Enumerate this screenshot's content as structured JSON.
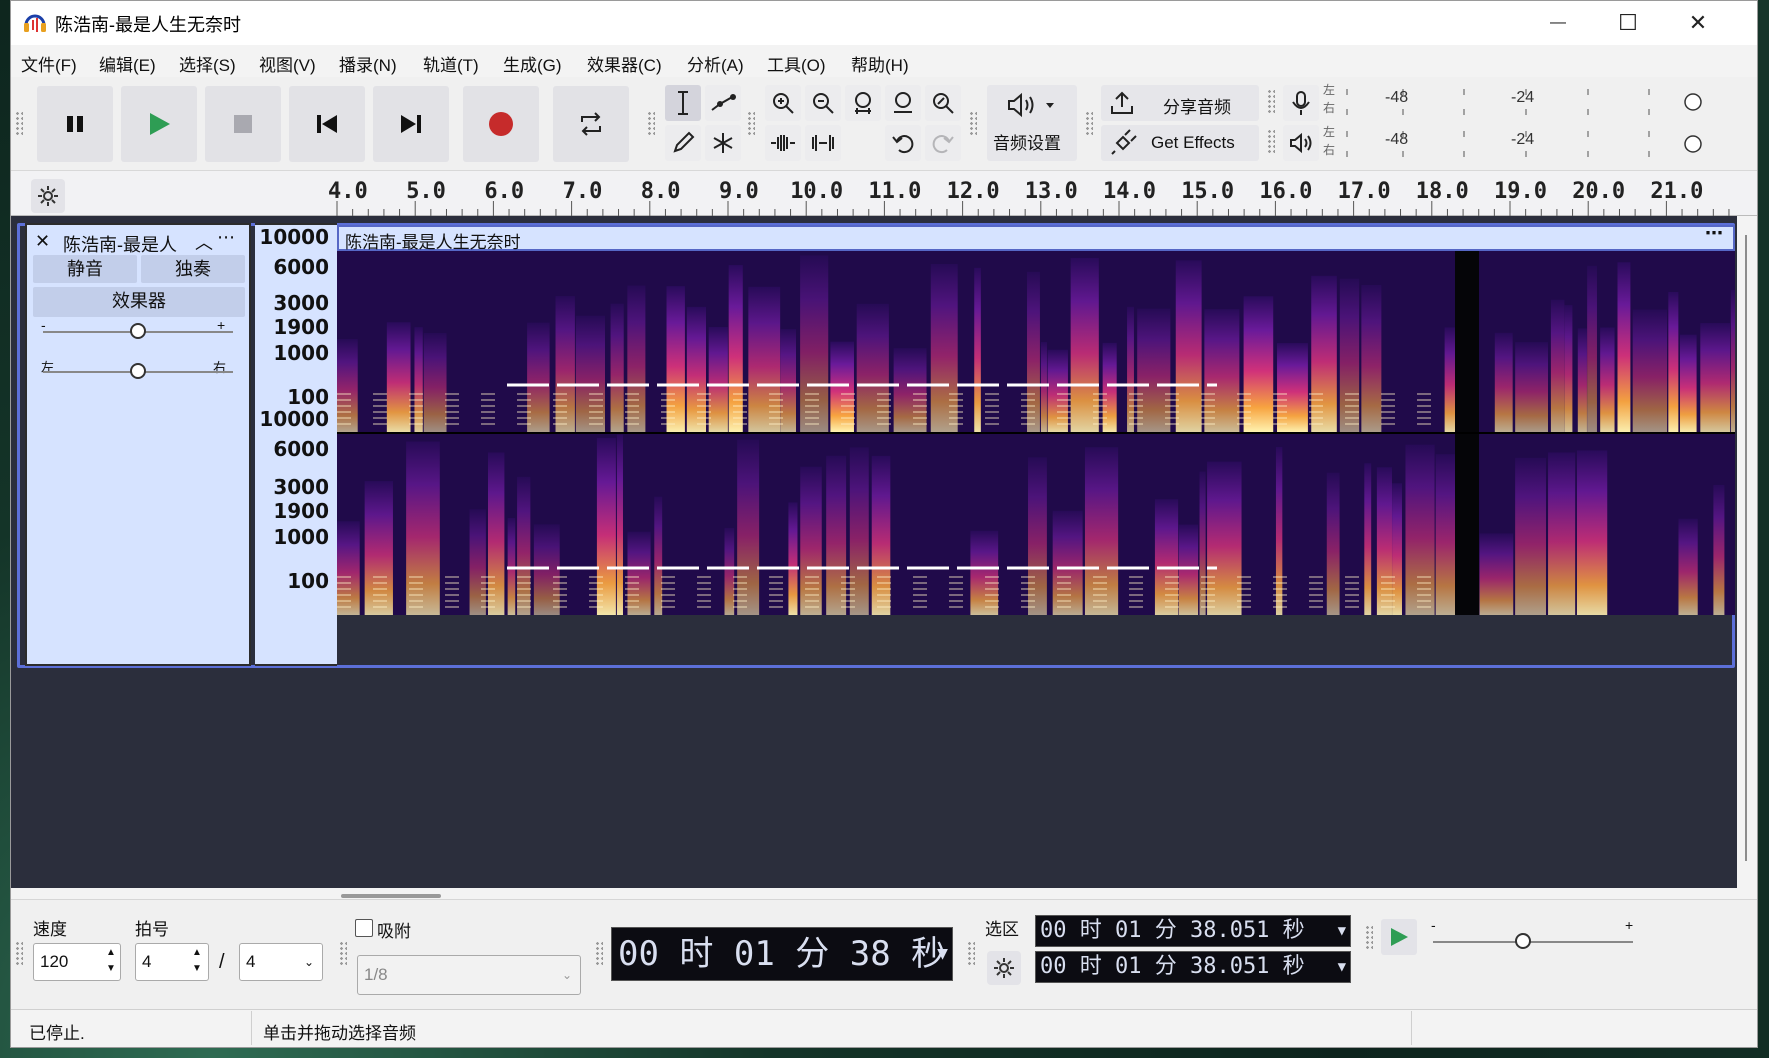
{
  "window": {
    "title": "陈浩南-最是人生无奈时",
    "minimize": "—",
    "maximize": "☐",
    "close": "✕"
  },
  "menu": [
    "文件(F)",
    "编辑(E)",
    "选择(S)",
    "视图(V)",
    "播录(N)",
    "轨道(T)",
    "生成(G)",
    "效果器(C)",
    "分析(A)",
    "工具(O)",
    "帮助(H)"
  ],
  "toolbar": {
    "audio_settings": "音频设置",
    "share_audio": "分享音频",
    "get_effects": "Get Effects",
    "meter_rec_label_l": "左",
    "meter_rec_label_r": "右",
    "meter_play_label_l": "左",
    "meter_play_label_r": "右",
    "meter_ticks": [
      "-48",
      "-24"
    ]
  },
  "ruler": {
    "labels": [
      "4.0",
      "5.0",
      "6.0",
      "7.0",
      "8.0",
      "9.0",
      "10.0",
      "11.0",
      "12.0",
      "13.0",
      "14.0",
      "15.0",
      "16.0",
      "17.0",
      "18.0",
      "19.0",
      "20.0",
      "21.0"
    ]
  },
  "track": {
    "name": "陈浩南-最是人",
    "clip_title": "陈浩南-最是人生无奈时",
    "mute": "静音",
    "solo": "独奏",
    "effects": "效果器",
    "gain_minus": "-",
    "gain_plus": "+",
    "pan_left": "左",
    "pan_right": "右",
    "gain_level": 0.5,
    "pan_level": 0.5,
    "freq_labels_top": [
      "10000",
      "6000",
      "3000",
      "1900",
      "1000",
      "100"
    ],
    "freq_labels_bottom": [
      "10000",
      "6000",
      "3000",
      "1900",
      "1000",
      "100"
    ]
  },
  "bottom": {
    "tempo_label": "速度",
    "tempo_value": "120",
    "timesig_label": "拍号",
    "timesig_num": "4",
    "timesig_sep": "/",
    "timesig_den": "4",
    "snap_label": "吸附",
    "snap_checked": false,
    "snap_value": "1/8",
    "time_display": "00 时 01 分 38 秒",
    "selection_label": "选区",
    "sel_start": "00 时 01 分 38.051 秒",
    "sel_end": "00 时 01 分 38.051 秒",
    "play_speed_minus": "-",
    "play_speed_plus": "+",
    "play_speed_level": 0.45
  },
  "status": {
    "state": "已停止.",
    "hint": "单击并拖动选择音频"
  },
  "colors": {
    "accent": "#4d5fc6",
    "play_green": "#2e9d54",
    "record_red": "#c62b2b",
    "track_bg": "#d6e3ff"
  }
}
